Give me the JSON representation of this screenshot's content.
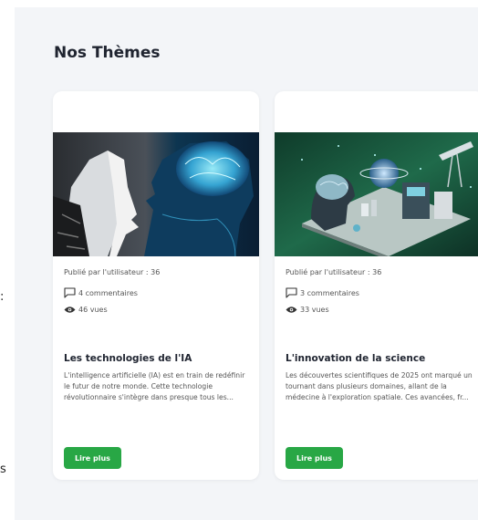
{
  "edge_fragments": [
    ":",
    "s"
  ],
  "section": {
    "title": "Nos Thèmes"
  },
  "cards": [
    {
      "image_alt": "AI robot face facing a human head with glowing brain",
      "published_by": "Publié par l'utilisateur : 36",
      "comments": "4 commentaires",
      "views": "46 vues",
      "title": "Les technologies de l'IA",
      "excerpt": "L'intelligence artificielle (IA) est en train de redéfinir le futur de notre monde. Cette technologie révolutionnaire s'intègre dans presque tous les...",
      "button_label": "Lire plus"
    },
    {
      "image_alt": "Isometric science lab with brain, planets and telescope",
      "published_by": "Publié par l'utilisateur : 36",
      "comments": "3 commentaires",
      "views": "33 vues",
      "title": "L'innovation de la science",
      "excerpt": "Les découvertes scientifiques de 2025 ont marqué un tournant dans plusieurs domaines, allant de la médecine à l'exploration spatiale. Ces avancées, fr...",
      "button_label": "Lire plus"
    }
  ],
  "colors": {
    "accent": "#28a745",
    "panel_bg": "#f3f5f8",
    "card_bg": "#ffffff"
  }
}
